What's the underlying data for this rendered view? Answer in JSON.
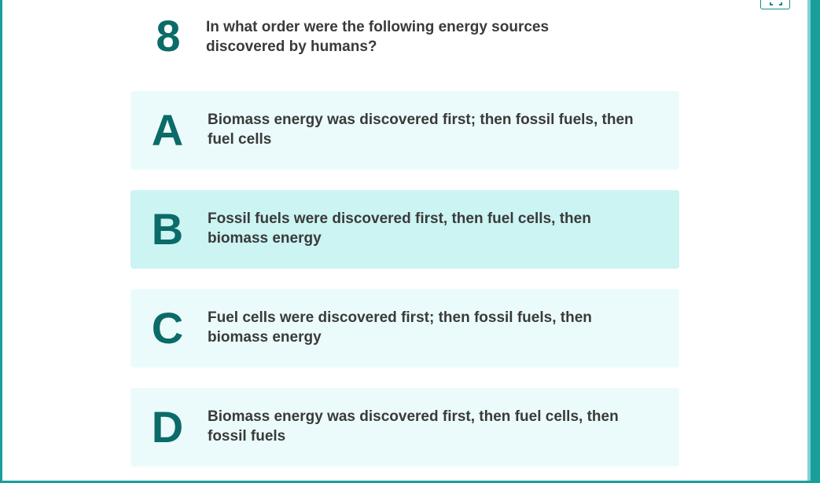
{
  "question": {
    "number": "8",
    "text": "In what order were the following energy sources discovered by humans?"
  },
  "options": [
    {
      "letter": "A",
      "text": "Biomass energy was discovered first; then fossil fuels, then fuel cells"
    },
    {
      "letter": "B",
      "text": "Fossil fuels were discovered first, then fuel cells, then biomass energy"
    },
    {
      "letter": "C",
      "text": "Fuel cells were discovered first; then fossil fuels, then biomass energy"
    },
    {
      "letter": "D",
      "text": "Biomass energy was discovered first, then fuel cells, then fossil fuels"
    }
  ],
  "selected_option": "B",
  "colors": {
    "accent": "#0b6b69",
    "frame": "#1a9e9c",
    "option_bg": "#ebfbfb",
    "option_selected_bg": "#cbf4f3",
    "text": "#3a3a3a"
  },
  "icons": {
    "expand": "expand-icon"
  }
}
